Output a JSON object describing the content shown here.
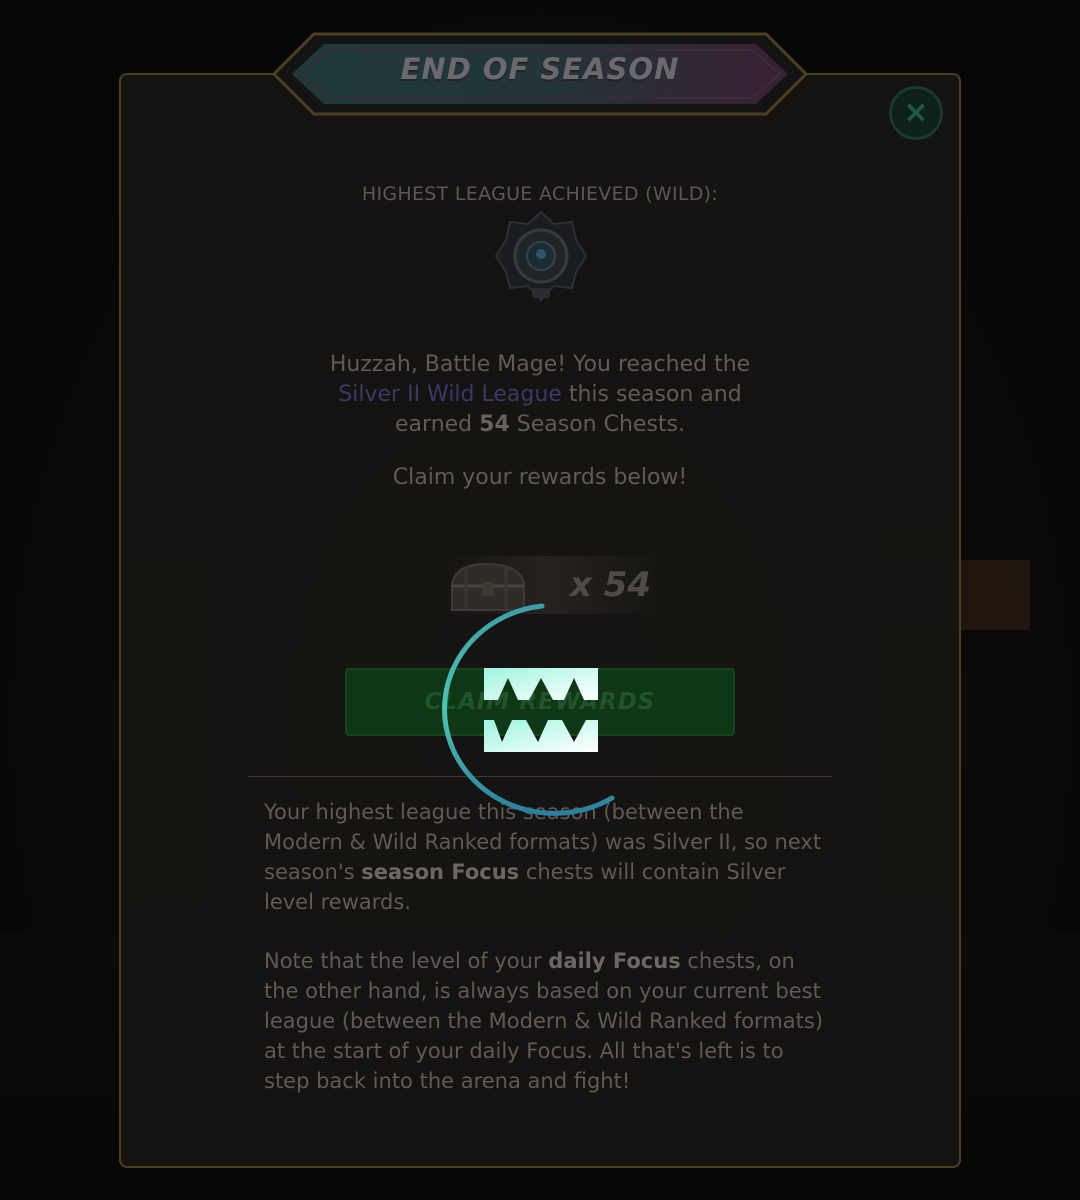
{
  "dialog": {
    "title": "END OF SEASON",
    "close_icon": "close-icon",
    "league_label": "HIGHEST LEAGUE ACHIEVED (WILD):",
    "league_badge_icon": "silver-league-badge-icon",
    "message": {
      "line1": "Huzzah, Battle Mage! You reached the",
      "league_name": "Silver II Wild League",
      "line2_suffix": " this season and",
      "line3_prefix": "earned ",
      "chest_count_bold": "54",
      "line3_suffix": " Season Chests."
    },
    "claim_prompt": "Claim your rewards below!",
    "reward": {
      "icon": "season-chest-icon",
      "quantity": "x 54"
    },
    "claim_button_label": "CLAIM REWARDS",
    "info_paragraph_1": {
      "before": "Your highest league this season (between the Modern & Wild Ranked formats) was Silver II, so next season's ",
      "bold": "season Focus",
      "after": " chests will contain Silver level rewards."
    },
    "info_paragraph_2": {
      "before": "Note that the level of your ",
      "bold": "daily Focus",
      "after": " chests, on the other hand, is always based on your current best league (between the Modern & Wild Ranked formats) at the start of your daily Focus. All that's left is to step back into the arena and fight!"
    }
  },
  "loader": {
    "icon": "loading-fangs-spinner-icon"
  },
  "colors": {
    "overlay": "#050505",
    "panel_border": "#4c3f1b",
    "button_green": "#0f3615",
    "link_purple": "#3e3666",
    "spinner_teal": "#4fc4b0"
  }
}
